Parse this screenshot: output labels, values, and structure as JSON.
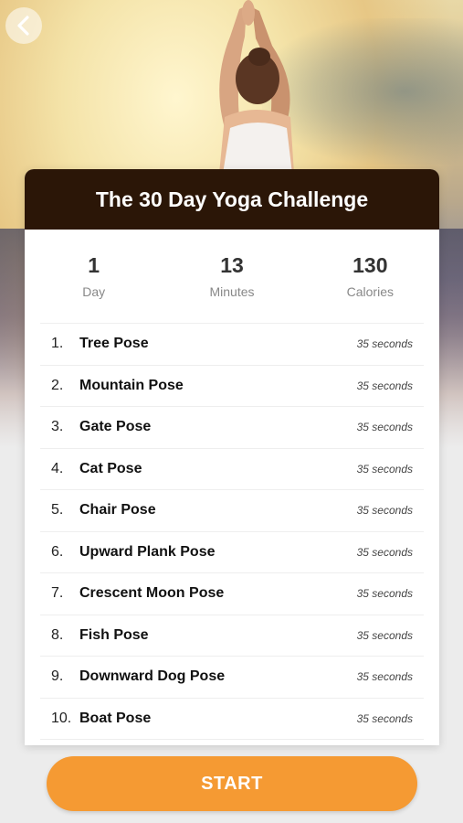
{
  "header": {
    "title": "The 30 Day Yoga Challenge"
  },
  "stats": [
    {
      "value": "1",
      "label": "Day"
    },
    {
      "value": "13",
      "label": "Minutes"
    },
    {
      "value": "130",
      "label": "Calories"
    }
  ],
  "poses": [
    {
      "num": "1.",
      "name": "Tree Pose",
      "duration": "35 seconds"
    },
    {
      "num": "2.",
      "name": "Mountain Pose",
      "duration": "35 seconds"
    },
    {
      "num": "3.",
      "name": "Gate Pose",
      "duration": "35 seconds"
    },
    {
      "num": "4.",
      "name": "Cat Pose",
      "duration": "35 seconds"
    },
    {
      "num": "5.",
      "name": "Chair Pose",
      "duration": "35 seconds"
    },
    {
      "num": "6.",
      "name": "Upward Plank Pose",
      "duration": "35 seconds"
    },
    {
      "num": "7.",
      "name": "Crescent Moon Pose",
      "duration": "35 seconds"
    },
    {
      "num": "8.",
      "name": "Fish Pose",
      "duration": "35 seconds"
    },
    {
      "num": "9.",
      "name": "Downward Dog Pose",
      "duration": "35 seconds"
    },
    {
      "num": "10.",
      "name": "Boat Pose",
      "duration": "35 seconds"
    }
  ],
  "start_button": {
    "label": "START"
  },
  "icons": {
    "back": "chevron-left-icon"
  },
  "colors": {
    "header_bg": "#2b1607",
    "start_bg": "#f59a33"
  }
}
